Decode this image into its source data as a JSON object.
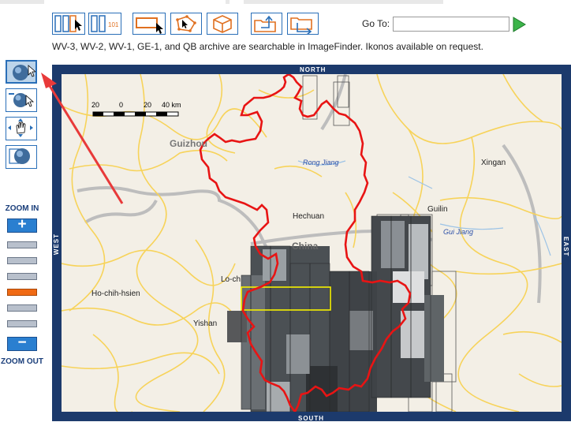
{
  "toolbar": {
    "buttons": [
      {
        "name": "select-tool-button"
      },
      {
        "name": "select-id-button",
        "badge": "101"
      },
      {
        "name": "draw-rectangle-button"
      },
      {
        "name": "draw-polygon-button"
      },
      {
        "name": "box-3d-button"
      },
      {
        "name": "export-button"
      },
      {
        "name": "import-button"
      }
    ],
    "goto_label": "Go To:",
    "goto_value": ""
  },
  "notice": "WV-3, WV-2, WV-1, GE-1, and QB archive are searchable in ImageFinder. Ikonos available on request.",
  "sidebar": {
    "zoom_in_label": "ZOOM IN",
    "zoom_out_label": "ZOOM OUT",
    "zoom_in_symbol": "+",
    "zoom_out_symbol": "−",
    "zoom_levels": 6,
    "zoom_active_level": 4
  },
  "map": {
    "compass": {
      "north": "NORTH",
      "south": "SOUTH",
      "east": "EAST",
      "west": "WEST"
    },
    "scale": {
      "ticks": [
        "20",
        "0",
        "20",
        "40 km"
      ]
    },
    "labels": {
      "guizhou": "Guizhou",
      "rongjiang": "Rong Jiang",
      "xingan": "Xingan",
      "hechuan": "Hechuan",
      "guilin": "Guilin",
      "china": "China",
      "guijiang": "Gui Jiang",
      "lochou": "Lo-ch",
      "hochih": "Ho-chih-hsien",
      "yishan": "Yishan"
    },
    "colors": {
      "land": "#f3efe6",
      "road": "#f7d35a",
      "boundary": "#e81414",
      "selection": "#f5f000",
      "frame": "#1c3a6c",
      "annotation_arrow": "#e83a3a"
    }
  }
}
